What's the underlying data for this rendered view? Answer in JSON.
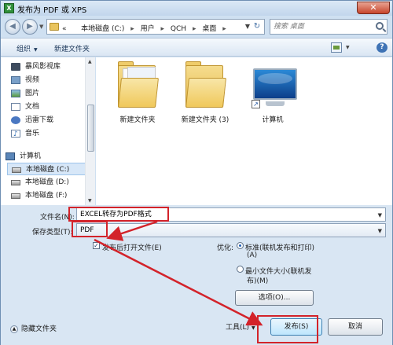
{
  "window": {
    "app_icon": "X",
    "title": "发布为 PDF 或 XPS",
    "close_glyph": "✕"
  },
  "address": {
    "overflow": "«",
    "breadcrumbs": [
      "本地磁盘 (C:)",
      "用户",
      "QCH",
      "桌面"
    ],
    "search_placeholder": "搜索 桌面"
  },
  "toolbar": {
    "organize_label": "组织",
    "new_folder_label": "新建文件夹",
    "help_glyph": "?"
  },
  "sidebar": {
    "items": [
      {
        "label": "暴风影视库",
        "icon": "film-icon"
      },
      {
        "label": "视频",
        "icon": "video-icon"
      },
      {
        "label": "图片",
        "icon": "picture-icon"
      },
      {
        "label": "文档",
        "icon": "document-icon"
      },
      {
        "label": "迅雷下载",
        "icon": "thunder-icon"
      },
      {
        "label": "音乐",
        "icon": "music-icon"
      },
      {
        "label": "计算机",
        "icon": "computer-icon"
      },
      {
        "label": "本地磁盘 (C:)",
        "icon": "drive-icon",
        "selected": true
      },
      {
        "label": "本地磁盘 (D:)",
        "icon": "drive-icon"
      },
      {
        "label": "本地磁盘 (F:)",
        "icon": "drive-icon"
      }
    ]
  },
  "files": [
    {
      "label": "新建文件夹",
      "icon": "folder-icon"
    },
    {
      "label": "新建文件夹 (3)",
      "icon": "folder-icon"
    },
    {
      "label": "计算机",
      "icon": "computer-icon"
    }
  ],
  "form": {
    "filename_label": "文件名(N):",
    "filename_value": "EXCEL转存为PDF格式",
    "savetype_label": "保存类型(T):",
    "savetype_value": "PDF",
    "open_after_label": "发布后打开文件(E)",
    "open_after_checked": true,
    "optimize_label": "优化:",
    "opt_standard_line1": "标准(联机发布和打印)",
    "opt_standard_line2": "(A)",
    "opt_min_line1": "最小文件大小(联机发",
    "opt_min_line2": "布)(M)",
    "options_button": "选项(O)..."
  },
  "footer": {
    "hide_folders": "隐藏文件夹",
    "tools_label": "工具(L)",
    "publish_label": "发布(S)",
    "cancel_label": "取消"
  },
  "annotation": {
    "color": "#d3232a",
    "check_glyph": "✓"
  }
}
